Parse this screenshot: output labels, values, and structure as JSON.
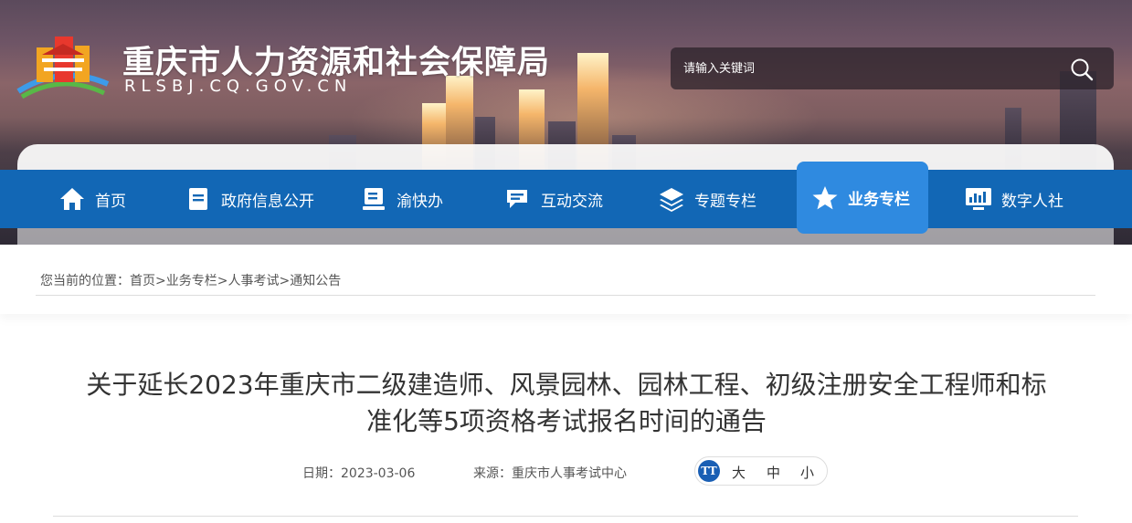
{
  "header": {
    "site_title": "重庆市人力资源和社会保障局",
    "site_domain": "RLSBJ.CQ.GOV.CN",
    "search_placeholder": "请输入关键词"
  },
  "nav": {
    "items": [
      {
        "label": "首页",
        "icon": "home-icon"
      },
      {
        "label": "政府信息公开",
        "icon": "document-icon"
      },
      {
        "label": "渝快办",
        "icon": "service-book-icon"
      },
      {
        "label": "互动交流",
        "icon": "chat-icon"
      },
      {
        "label": "专题专栏",
        "icon": "layers-icon"
      },
      {
        "label": "业务专栏",
        "icon": "star-icon",
        "active": true
      },
      {
        "label": "数字人社",
        "icon": "monitor-chart-icon"
      }
    ]
  },
  "breadcrumb": {
    "prefix": "您当前的位置：",
    "items": [
      "首页",
      "业务专栏",
      "人事考试",
      "通知公告"
    ],
    "separator": ">"
  },
  "article": {
    "title_line1": "关于延长2023年重庆市二级建造师、风景园林、园林工程、初级注册安全工程师和标",
    "title_line2": "准化等5项资格考试报名时间的通告",
    "date_label": "日期：",
    "date": "2023-03-06",
    "source_label": "来源：",
    "source": "重庆市人事考试中心",
    "font_size_badge": "TT",
    "font_large": "大",
    "font_medium": "中",
    "font_small": "小"
  },
  "colors": {
    "nav_bg": "#1267b5",
    "nav_active": "#2f8ae0",
    "font_badge": "#1a5fb4"
  }
}
